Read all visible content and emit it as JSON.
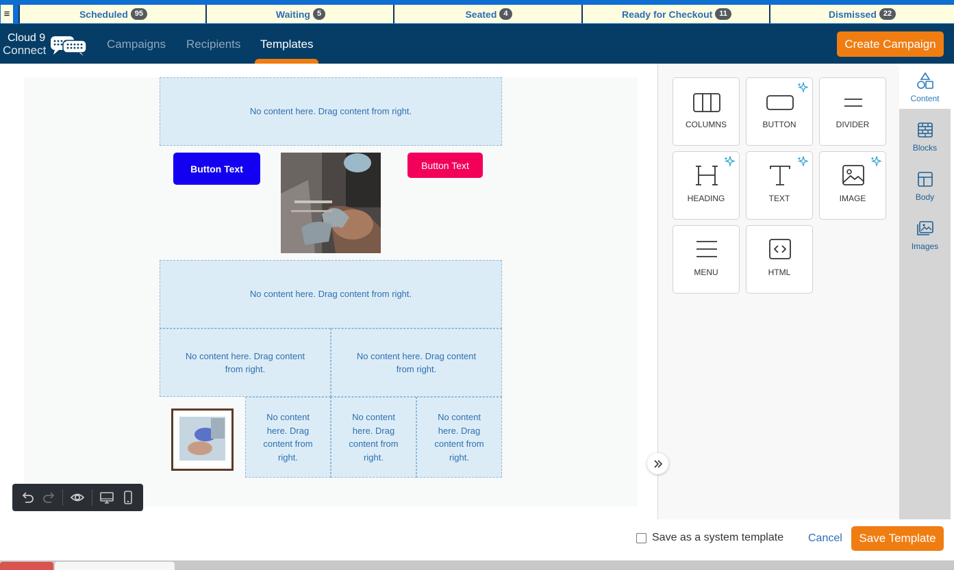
{
  "status_tabs": [
    {
      "label": "Scheduled",
      "count": "95"
    },
    {
      "label": "Waiting",
      "count": "5"
    },
    {
      "label": "Seated",
      "count": "4"
    },
    {
      "label": "Ready for Checkout",
      "count": "11"
    },
    {
      "label": "Dismissed",
      "count": "22"
    }
  ],
  "menu_icon": "≡",
  "brand": {
    "line1": "Cloud 9",
    "line2": "Connect"
  },
  "nav": {
    "links": [
      "Campaigns",
      "Recipients",
      "Templates"
    ],
    "active": "Templates",
    "create_button": "Create Campaign"
  },
  "canvas": {
    "placeholder": "No content here. Drag content from right.",
    "button_blue": "Button Text",
    "button_pink": "Button Text"
  },
  "toolbar": {
    "icons": [
      "undo-icon",
      "redo-icon",
      "preview-eye-icon",
      "desktop-icon",
      "mobile-icon"
    ]
  },
  "tools": [
    {
      "label": "COLUMNS",
      "icon": "columns-icon",
      "ai": false
    },
    {
      "label": "BUTTON",
      "icon": "button-icon",
      "ai": true
    },
    {
      "label": "DIVIDER",
      "icon": "divider-icon",
      "ai": false
    },
    {
      "label": "HEADING",
      "icon": "heading-icon",
      "ai": true
    },
    {
      "label": "TEXT",
      "icon": "text-icon",
      "ai": true
    },
    {
      "label": "IMAGE",
      "icon": "image-icon",
      "ai": true
    },
    {
      "label": "MENU",
      "icon": "menu-icon",
      "ai": false
    },
    {
      "label": "HTML",
      "icon": "html-icon",
      "ai": false
    }
  ],
  "sidebar": {
    "items": [
      {
        "label": "Content",
        "icon": "shapes-icon"
      },
      {
        "label": "Blocks",
        "icon": "blocks-icon"
      },
      {
        "label": "Body",
        "icon": "layout-icon"
      },
      {
        "label": "Images",
        "icon": "images-icon"
      }
    ],
    "active": "Content"
  },
  "footer": {
    "system_template_label": "Save as a system template",
    "cancel": "Cancel",
    "save": "Save Template"
  },
  "colors": {
    "accent": "#f07d12",
    "nav_bg": "#053d66",
    "dropzone_bg": "#dcecf6",
    "link": "#2d6ebd"
  }
}
